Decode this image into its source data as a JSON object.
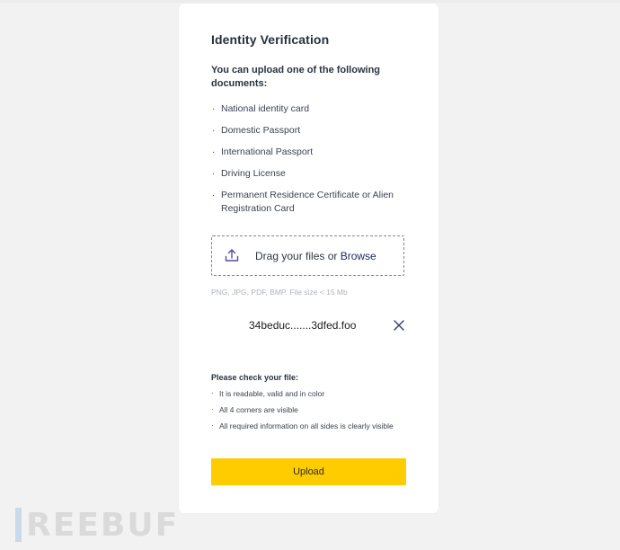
{
  "card": {
    "title": "Identity Verification",
    "intro": "You can upload one of the following documents:",
    "documents": [
      "National identity card",
      "Domestic Passport",
      "International Passport",
      "Driving License",
      "Permanent Residence Certificate or Alien Registration Card"
    ],
    "bullet": "·"
  },
  "dropzone": {
    "prompt": "Drag your files or ",
    "browse_label": "Browse",
    "icon": "upload-icon"
  },
  "hint": "PNG, JPG, PDF, BMP. File size < 15 Mb",
  "file": {
    "name": "34beduc.......3dfed.foo",
    "remove_icon": "close-icon"
  },
  "checks": {
    "title": "Please check your file:",
    "items": [
      "It is readable, valid and in color",
      "All 4 corners are visible",
      "All required information on all sides is clearly visible"
    ]
  },
  "upload_button": "Upload",
  "watermark": {
    "text": "REEBUF"
  },
  "colors": {
    "accent": "#ffcc00",
    "link": "#1f2a66",
    "icon": "#5a4a9c"
  }
}
